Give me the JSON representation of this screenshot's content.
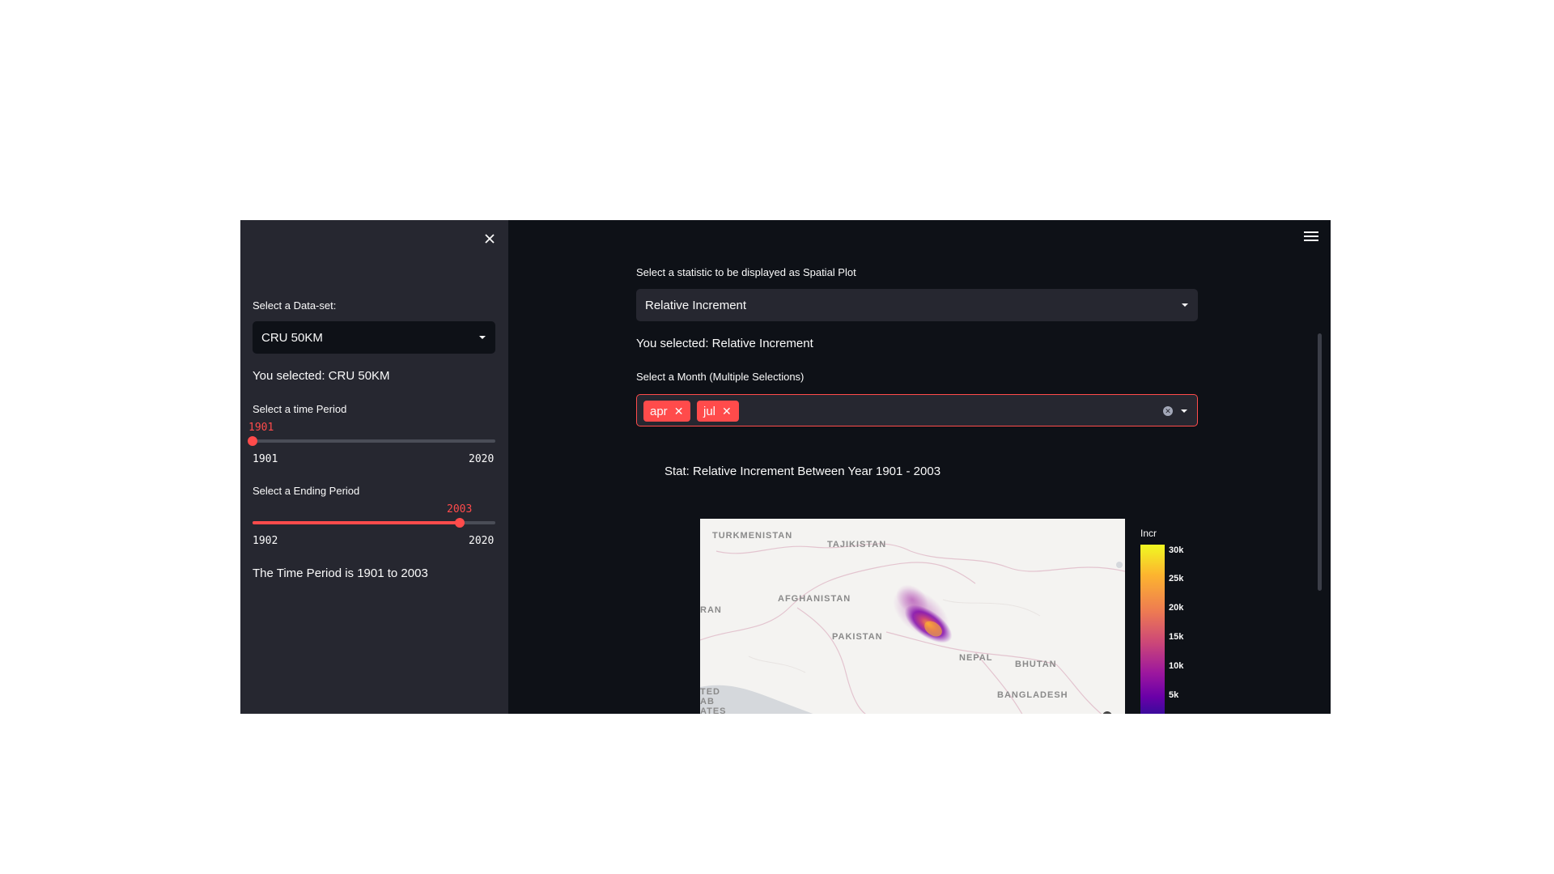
{
  "sidebar": {
    "dataset_label": "Select a Data-set:",
    "dataset_value": "CRU 50KM",
    "dataset_selected": "You selected: CRU 50KM",
    "time_label": "Select a time Period",
    "time_value": "1901",
    "time_min": "1901",
    "time_max": "2020",
    "time_fraction": 0.0,
    "end_label": "Select a Ending Period",
    "end_value": "2003",
    "end_min": "1902",
    "end_max": "2020",
    "end_fraction": 0.854,
    "period_text": "The Time Period is 1901 to 2003"
  },
  "main": {
    "stat_label": "Select a statistic to be displayed as Spatial Plot",
    "stat_value": "Relative Increment",
    "stat_selected": "You selected: Relative Increment",
    "month_label": "Select a Month (Multiple Selections)",
    "months": [
      "apr",
      "jul"
    ],
    "chart_title": "Stat: Relative Increment Between Year 1901 - 2003"
  },
  "map": {
    "labels": {
      "turkmenistan": "TURKMENISTAN",
      "tajikistan": "TAJIKISTAN",
      "afghanistan": "AFGHANISTAN",
      "iran": "RAN",
      "pakistan": "PAKISTAN",
      "nepal": "NEPAL",
      "bhutan": "BHUTAN",
      "bangladesh": "BANGLADESH",
      "uae_1": "TED",
      "uae_2": "AB",
      "uae_3": "ATES"
    },
    "colorbar_title": "Incr",
    "colorbar_ticks": [
      "30k",
      "25k",
      "20k",
      "15k",
      "10k",
      "5k"
    ]
  },
  "colors": {
    "accent": "#ff4b4b",
    "background": "#0e1117",
    "sidebar": "#262730"
  }
}
